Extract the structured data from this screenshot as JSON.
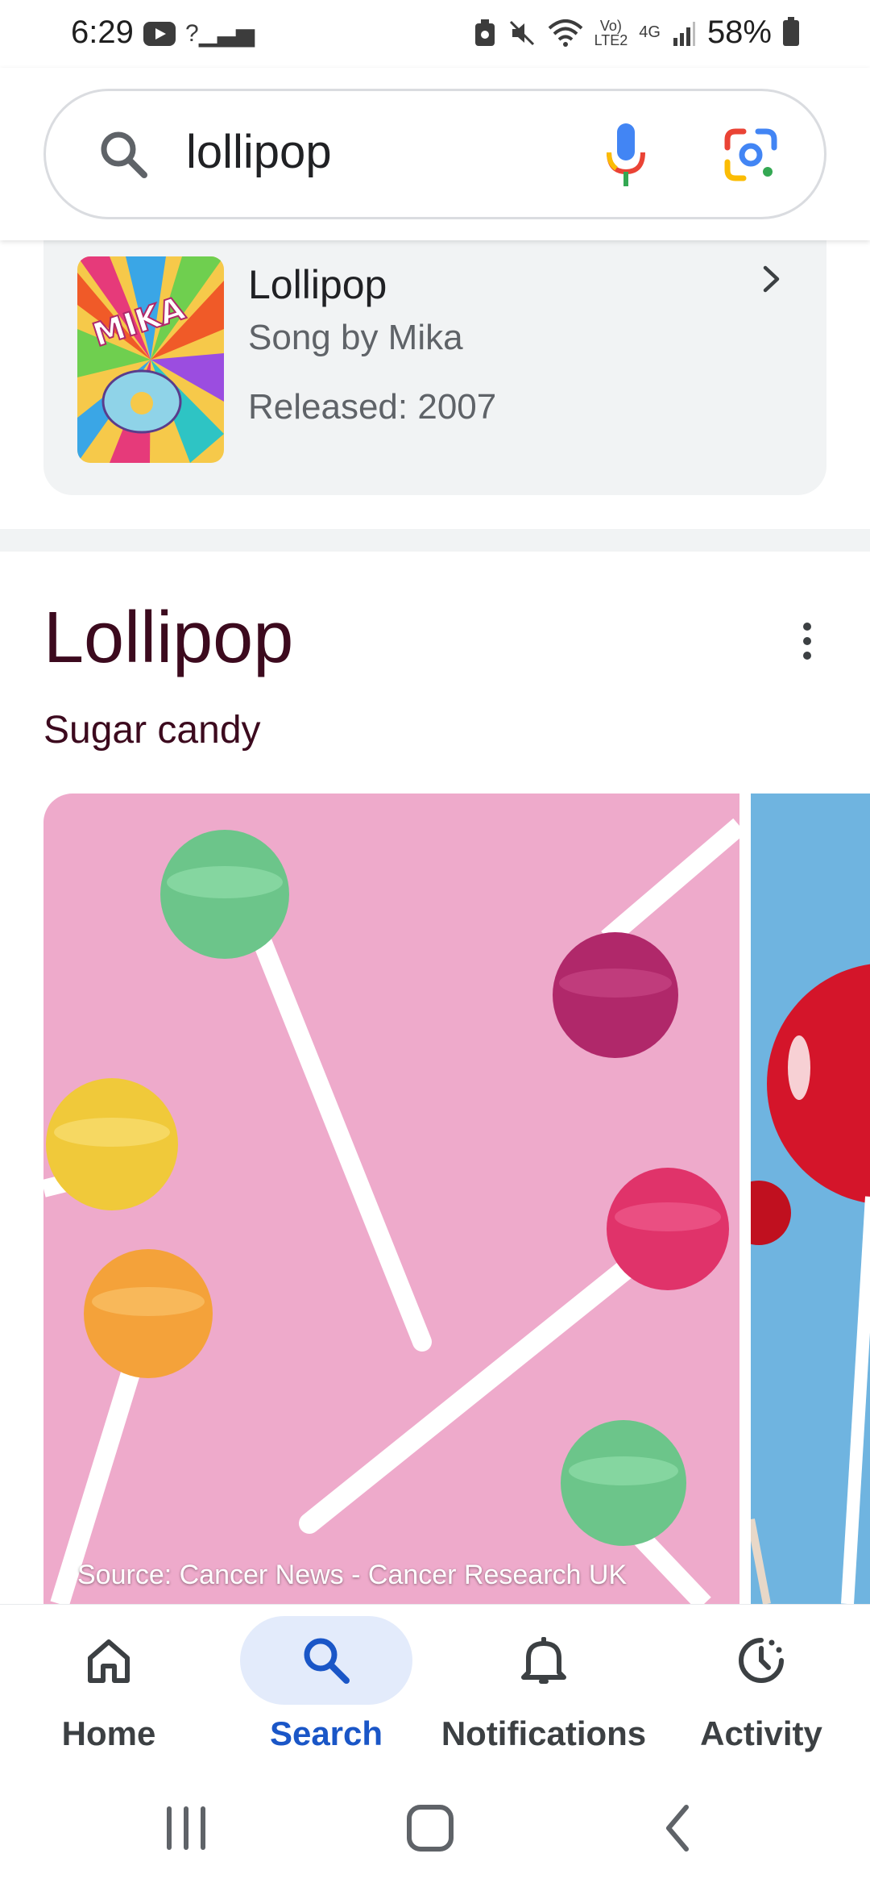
{
  "status_bar": {
    "time": "6:29",
    "signal_left": "?",
    "network_label_1": "Vo)",
    "network_label_2": "LTE2",
    "network_type": "4G",
    "battery": "58%"
  },
  "search": {
    "query": "lollipop"
  },
  "song_card": {
    "title": "Lollipop",
    "subtitle": "Song by Mika",
    "released": "Released: 2007",
    "album_art_text": "MIKA"
  },
  "knowledge_panel": {
    "title": "Lollipop",
    "subtitle": "Sugar candy",
    "image_source": "Source: Cancer News - Cancer Research UK"
  },
  "bottom_nav": {
    "items": [
      {
        "label": "Home",
        "icon": "home-icon",
        "active": false
      },
      {
        "label": "Search",
        "icon": "search-icon",
        "active": true
      },
      {
        "label": "Notifications",
        "icon": "bell-icon",
        "active": false
      },
      {
        "label": "Activity",
        "icon": "activity-icon",
        "active": false
      }
    ]
  },
  "colors": {
    "accent": "#1a56c7",
    "active_pill": "#e3ebfb",
    "kp_title": "#3c0a1e",
    "card_bg": "#f1f3f4"
  }
}
